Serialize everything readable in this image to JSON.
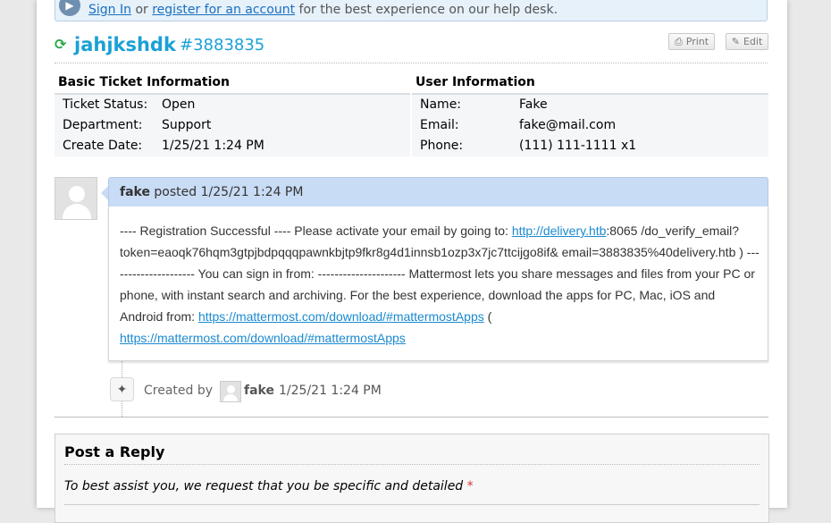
{
  "notice": {
    "sign_in": "Sign In",
    "or": "or",
    "register": "register for an account",
    "tail": "for the best experience on our help desk."
  },
  "ticket": {
    "subject": "jahjkshdk",
    "number": "#3883835",
    "print_label": "Print",
    "edit_label": "Edit"
  },
  "basic_info": {
    "heading": "Basic Ticket Information",
    "rows": [
      {
        "label": "Ticket Status:",
        "value": "Open"
      },
      {
        "label": "Department:",
        "value": "Support"
      },
      {
        "label": "Create Date:",
        "value": "1/25/21 1:24 PM"
      }
    ]
  },
  "user_info": {
    "heading": "User Information",
    "rows": [
      {
        "label": "Name:",
        "value": "Fake"
      },
      {
        "label": "Email:",
        "value": "fake@mail.com"
      },
      {
        "label": "Phone:",
        "value": "(111) 111-1111 x1"
      }
    ]
  },
  "message": {
    "author": "fake",
    "posted": "posted",
    "date": "1/25/21 1:24 PM",
    "text_1": "---- Registration Successful ---- Please activate your email by going to: ",
    "link_1": "http://delivery.htb",
    "text_2": ":8065 /do_verify_email?token=eaoqk76hqm3gtpjbdpqqqpawnkbjtp9fkr8g4d1innsb1ozp3x7jc7ttcijgo8if& email=3883835%40delivery.htb ) --------------------- You can sign in from: --------------------- Mattermost lets you share messages and files from your PC or phone, with instant search and archiving. For the best experience, download the apps for PC, Mac, iOS and Android from: ",
    "link_2": "https://mattermost.com/download/#mattermostApps",
    "text_3": " ( ",
    "link_3": "https://mattermost.com/download/#mattermostApps"
  },
  "event": {
    "created_by": "Created by",
    "user": "fake",
    "date": "1/25/21 1:24 PM"
  },
  "reply": {
    "title": "Post a Reply",
    "hint": "To best assist you, we request that you be specific and detailed",
    "required_mark": "*"
  },
  "colors": {
    "accent": "#1aa1d6",
    "link": "#1a6fbf",
    "message_header": "#c9dcf5"
  }
}
